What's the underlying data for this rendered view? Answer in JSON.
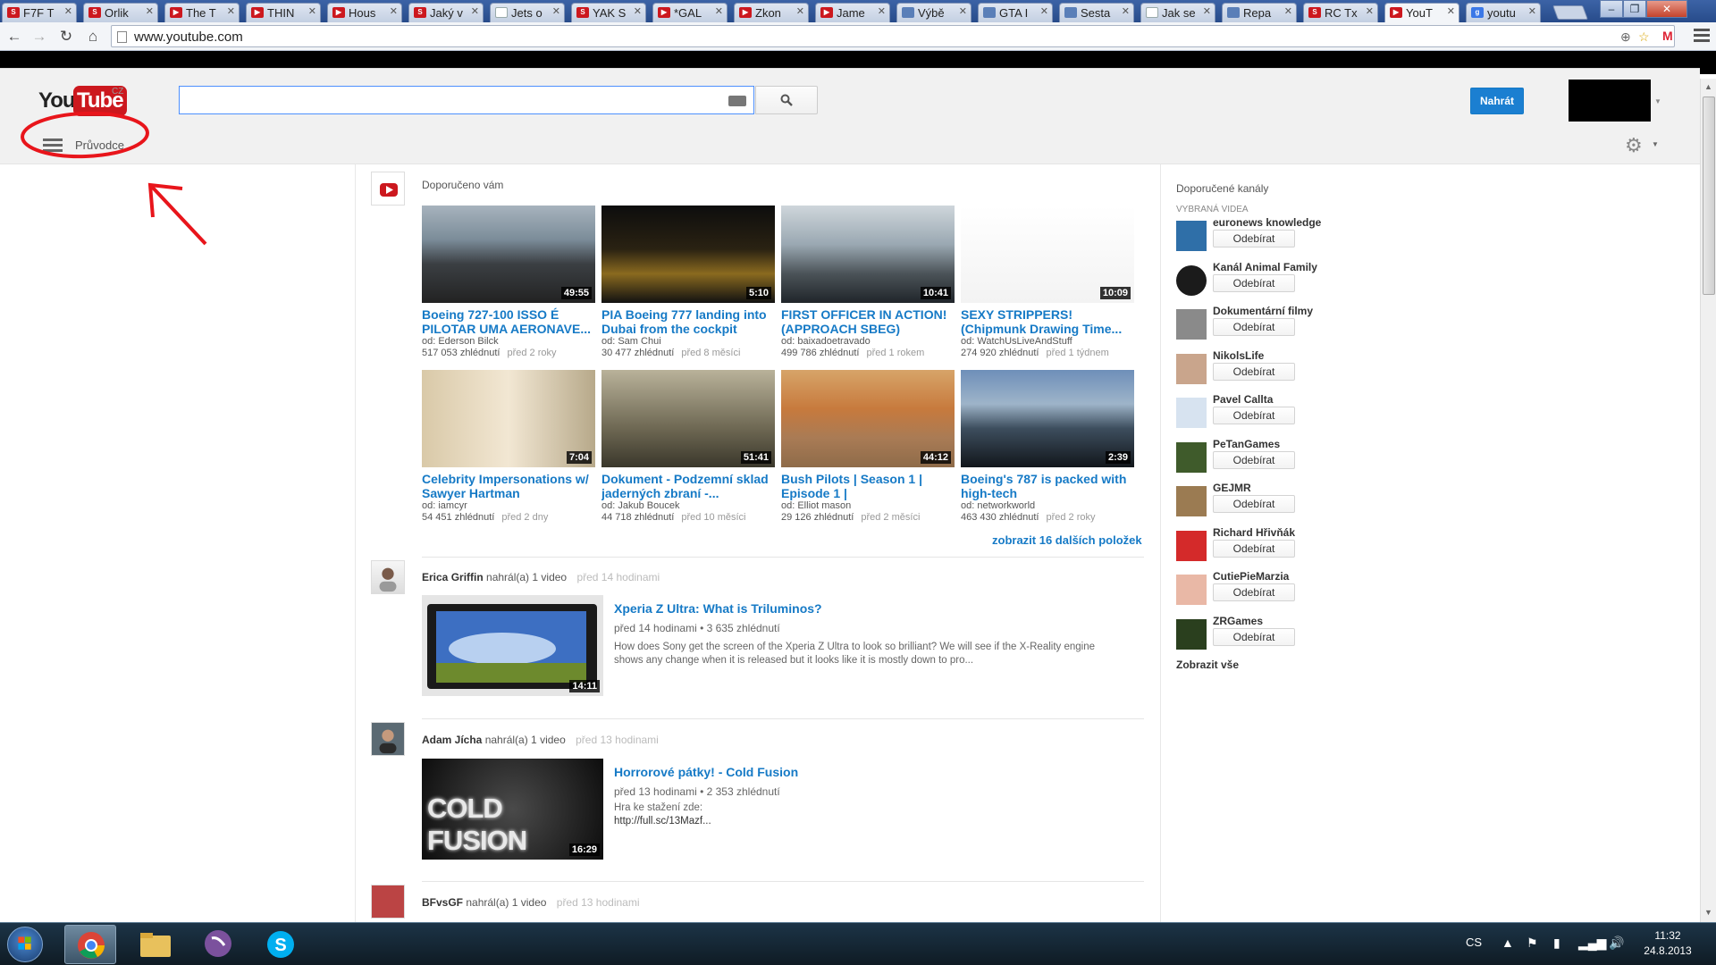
{
  "browser": {
    "tabs": [
      {
        "title": "F7F T",
        "favicon": "S"
      },
      {
        "title": "Orlik",
        "favicon": "S"
      },
      {
        "title": "The T",
        "favicon": "▶"
      },
      {
        "title": "THIN",
        "favicon": "▶"
      },
      {
        "title": "Hous",
        "favicon": "▶"
      },
      {
        "title": "Jaký v",
        "favicon": "S"
      },
      {
        "title": "Jets o",
        "favicon": "doc"
      },
      {
        "title": "YAK S",
        "favicon": "S"
      },
      {
        "title": "*GAL",
        "favicon": "▶"
      },
      {
        "title": "Zkon",
        "favicon": "▶"
      },
      {
        "title": "Jame",
        "favicon": "▶"
      },
      {
        "title": "Výbě",
        "favicon": "ic"
      },
      {
        "title": "GTA I",
        "favicon": "ic"
      },
      {
        "title": "Sesta",
        "favicon": "ic"
      },
      {
        "title": "Jak se",
        "favicon": "doc"
      },
      {
        "title": "Repa",
        "favicon": "ic"
      },
      {
        "title": "RC Tx",
        "favicon": "S"
      },
      {
        "title": "YouT",
        "favicon": "▶"
      },
      {
        "title": "youtu",
        "favicon": "g"
      }
    ],
    "url": "www.youtube.com"
  },
  "masthead": {
    "logo_you": "You",
    "logo_tube": "Tube",
    "logo_region": "CZ",
    "search_placeholder": "",
    "upload_label": "Nahrát",
    "guide_label": "Průvodce"
  },
  "feed": {
    "recommended_label": "Doporučeno vám",
    "more_link": "zobrazit 16 dalších položek",
    "recommended_videos": [
      {
        "title": "Boeing 727-100 ISSO É PILOTAR UMA AERONAVE...",
        "by": "od: Ederson Bilck",
        "views": "517 053 zhlédnutí",
        "age": "před 2 roky",
        "duration": "49:55"
      },
      {
        "title": "PIA Boeing 777 landing into Dubai from the cockpit",
        "by": "od: Sam Chui",
        "views": "30 477 zhlédnutí",
        "age": "před 8 měsíci",
        "duration": "5:10"
      },
      {
        "title": "FIRST OFFICER IN ACTION! (APPROACH SBEG)",
        "by": "od: baixadoetravado",
        "views": "499 786 zhlédnutí",
        "age": "před 1 rokem",
        "duration": "10:41"
      },
      {
        "title": "SEXY STRIPPERS! (Chipmunk Drawing Time...",
        "by": "od: WatchUsLiveAndStuff",
        "views": "274 920 zhlédnutí",
        "age": "před 1 týdnem",
        "duration": "10:09"
      },
      {
        "title": "Celebrity Impersonations w/ Sawyer Hartman",
        "by": "od: iamcyr",
        "views": "54 451 zhlédnutí",
        "age": "před 2 dny",
        "duration": "7:04"
      },
      {
        "title": "Dokument - Podzemní sklad jaderných zbraní -...",
        "by": "od: Jakub Boucek",
        "views": "44 718 zhlédnutí",
        "age": "před 10 měsíci",
        "duration": "51:41"
      },
      {
        "title": "Bush Pilots | Season 1 | Episode 1 |",
        "by": "od: Elliot mason",
        "views": "29 126 zhlédnutí",
        "age": "před 2 měsíci",
        "duration": "44:12"
      },
      {
        "title": "Boeing's 787 is packed with high-tech",
        "by": "od: networkworld",
        "views": "463 430 zhlédnutí",
        "age": "před 2 roky",
        "duration": "2:39"
      }
    ],
    "uploads": [
      {
        "user": "Erica Griffin",
        "action": "nahrál(a) 1 video",
        "age": "před 14 hodinami",
        "title": "Xperia Z Ultra: What is Triluminos?",
        "meta_age": "před 14 hodinami",
        "views": "3 635 zhlédnutí",
        "desc": "How does Sony get the screen of the Xperia Z Ultra to look so brilliant? We will see if the X-Reality engine shows any change when it is released but it looks like it is mostly down to pro...",
        "duration": "14:11"
      },
      {
        "user": "Adam Jícha",
        "action": "nahrál(a) 1 video",
        "age": "před 13 hodinami",
        "title": "Horrorové pátky! - Cold Fusion",
        "meta_age": "před 13 hodinami",
        "views": "2 353 zhlédnutí",
        "desc": "Hra ke stažení zde:",
        "link": "http://full.sc/13Mazf...",
        "thumb_text": "COLD FUSION",
        "duration": "16:29"
      },
      {
        "user": "BFvsGF",
        "action": "nahrál(a) 1 video",
        "age": "před 13 hodinami"
      }
    ]
  },
  "sidebar": {
    "title": "Doporučené kanály",
    "subtitle": "VYBRANÁ VIDEA",
    "subscribe_label": "Odebírat",
    "show_all": "Zobrazit vše",
    "channels": [
      {
        "name": "euronews knowledge"
      },
      {
        "name": "Kanál Animal Family"
      },
      {
        "name": "Dokumentární filmy"
      },
      {
        "name": "NikolsLife"
      },
      {
        "name": "Pavel Callta"
      },
      {
        "name": "PeTanGames"
      },
      {
        "name": "GEJMR"
      },
      {
        "name": "Richard Hřivňák"
      },
      {
        "name": "CutiePieMarzia"
      },
      {
        "name": "ZRGames"
      }
    ]
  },
  "taskbar": {
    "lang": "CS",
    "time": "11:32",
    "date": "24.8.2013"
  },
  "colors": {
    "accent": "#167ac6",
    "brand_red": "#cc181e",
    "annotation": "#e8151b"
  }
}
